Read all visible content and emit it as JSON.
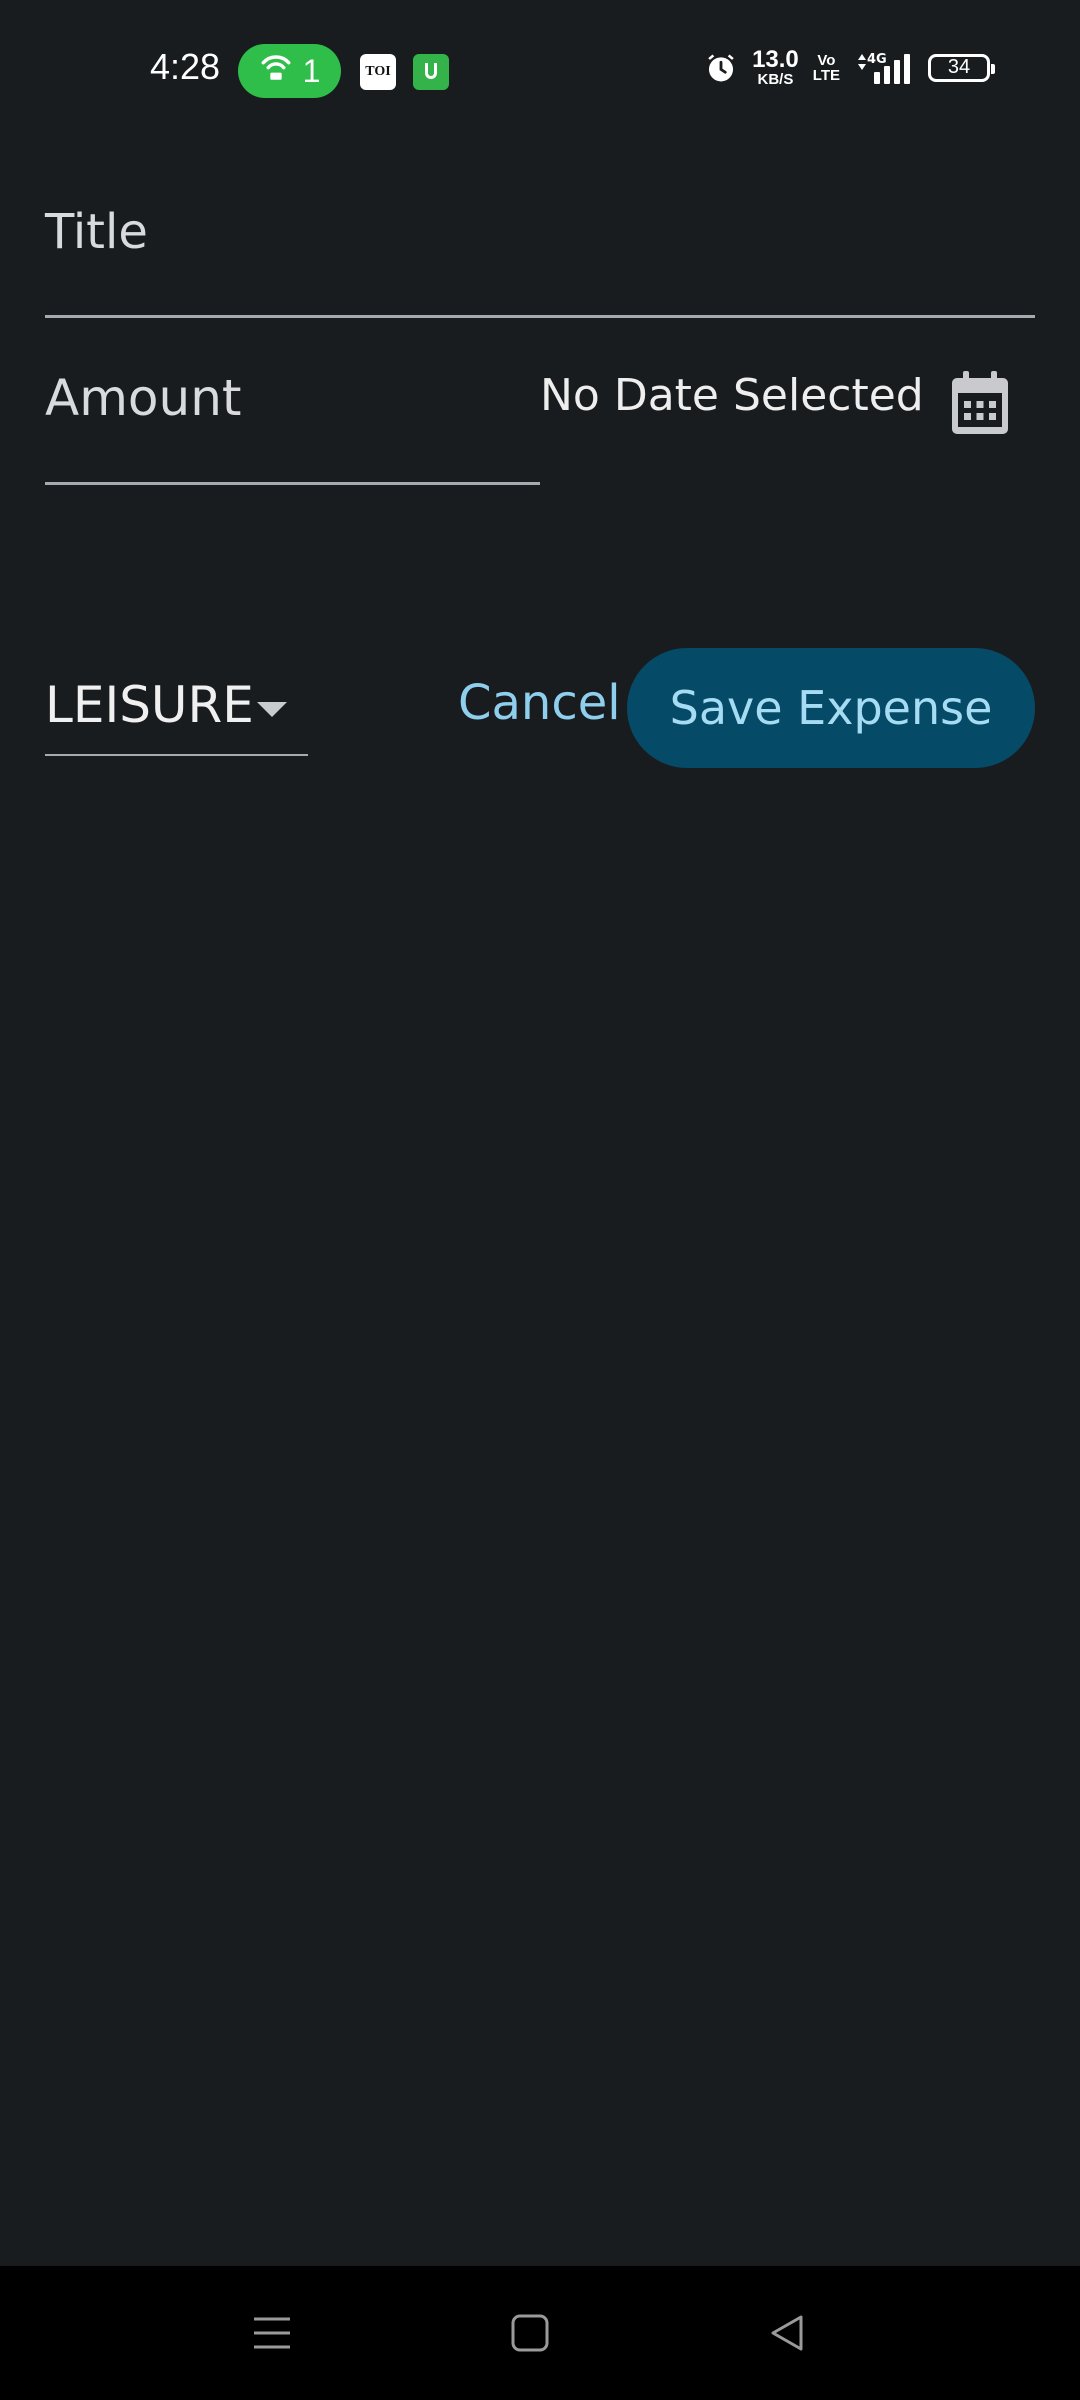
{
  "status_bar": {
    "time": "4:28",
    "hotspot_count": "1",
    "toi_badge": "TOI",
    "net_speed_value": "13.0",
    "net_speed_unit": "KB/S",
    "volte_top": "Vo",
    "volte_bottom": "LTE",
    "network_type": "4G",
    "battery_level": "34",
    "hotspot_color": "#2fbe4a"
  },
  "form": {
    "title_placeholder": "Title",
    "amount_placeholder": "Amount",
    "date_text": "No Date Selected",
    "calendar_icon": "calendar-icon",
    "category_value": "LEISURE",
    "cancel_label": "Cancel",
    "save_label": "Save Expense"
  },
  "theme": {
    "background": "#191c1f",
    "accent_text": "#8fcfee",
    "save_button_bg": "#054a66"
  },
  "nav_bar": {
    "icons": [
      "menu-icon",
      "home-icon",
      "back-icon"
    ]
  }
}
